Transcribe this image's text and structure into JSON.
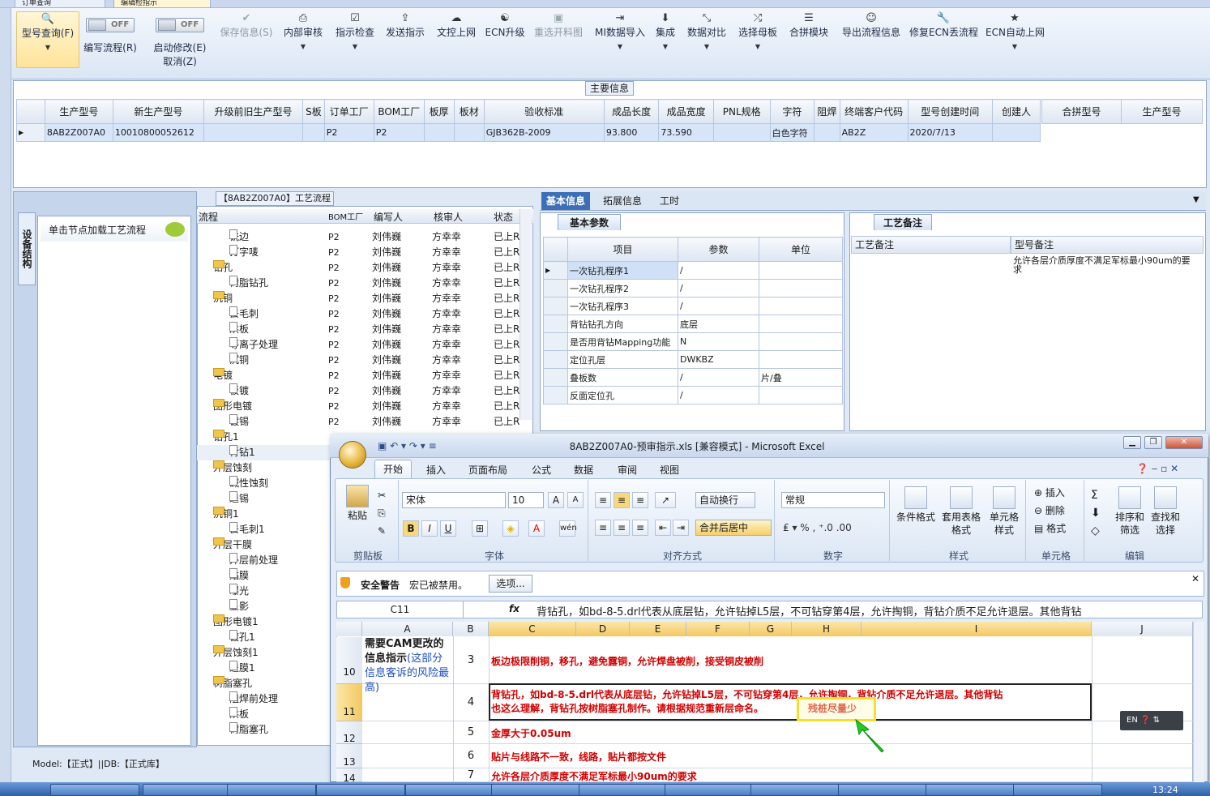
{
  "top_tabs": [
    "订单查询",
    "编辑检指示"
  ],
  "ribbon": {
    "model_query": "型号查询(F)",
    "toggle_off": "OFF",
    "write_flow": "编写流程(R)",
    "start_modify": "启动修改(E)",
    "cancel": "取消(Z)",
    "buttons": [
      "保存信息(S)",
      "内部审核",
      "指示检查",
      "发送指示",
      "文控上网",
      "ECN升级",
      "重选开料图",
      "MI数据导入",
      "集成",
      "数据对比",
      "选择母板",
      "合拼模块",
      "导出流程信息",
      "修复ECN丢流程",
      "ECN自动上网"
    ]
  },
  "main_info": {
    "title": "主要信息",
    "columns": [
      "生产型号",
      "新生产型号",
      "升级前旧生产型号",
      "S板",
      "订单工厂",
      "BOM工厂",
      "板厚",
      "板材",
      "验收标准",
      "成品长度",
      "成品宽度",
      "PNL规格",
      "字符",
      "阻焊",
      "终端客户代码",
      "型号创建时间",
      "创建人"
    ],
    "row": [
      "8AB2Z007A0",
      "10010800052612",
      "",
      "",
      "P2",
      "P2",
      "",
      "",
      "GJB362B-2009",
      "93.800",
      "73.590",
      "",
      "白色字符",
      "",
      "AB2Z",
      "2020/7/13",
      ""
    ],
    "merge_columns": [
      "合拼型号",
      "生产型号"
    ]
  },
  "left_panel": {
    "tab": "设备结构",
    "hint": "单击节点加载工艺流程"
  },
  "flow": {
    "title": "【8AB2Z007A0】工艺流程",
    "columns": [
      "流程",
      "BOM工厂",
      "编写人",
      "核审人",
      "状态"
    ],
    "rows": [
      {
        "n": "铣边",
        "t": "d",
        "l": 2,
        "b": "P2",
        "w": "刘伟巍",
        "r": "方幸幸",
        "s": "已上R"
      },
      {
        "n": "打字唛",
        "t": "d",
        "l": 2,
        "b": "P2",
        "w": "刘伟巍",
        "r": "方幸幸",
        "s": "已上R"
      },
      {
        "n": "钻孔",
        "t": "f",
        "l": 1,
        "b": "P2",
        "w": "刘伟巍",
        "r": "方幸幸",
        "s": "已上R"
      },
      {
        "n": "树脂钻孔",
        "t": "d",
        "l": 2,
        "b": "P2",
        "w": "刘伟巍",
        "r": "方幸幸",
        "s": "已上R"
      },
      {
        "n": "沉铜",
        "t": "f",
        "l": 1,
        "b": "P2",
        "w": "刘伟巍",
        "r": "方幸幸",
        "s": "已上R"
      },
      {
        "n": "去毛刺",
        "t": "d",
        "l": 2,
        "b": "P2",
        "w": "刘伟巍",
        "r": "方幸幸",
        "s": "已上R"
      },
      {
        "n": "烘板",
        "t": "d",
        "l": 2,
        "b": "P2",
        "w": "刘伟巍",
        "r": "方幸幸",
        "s": "已上R"
      },
      {
        "n": "等离子处理",
        "t": "d",
        "l": 2,
        "b": "P2",
        "w": "刘伟巍",
        "r": "方幸幸",
        "s": "已上R"
      },
      {
        "n": "沉铜",
        "t": "d",
        "l": 2,
        "b": "P2",
        "w": "刘伟巍",
        "r": "方幸幸",
        "s": "已上R"
      },
      {
        "n": "电镀",
        "t": "f",
        "l": 1,
        "b": "P2",
        "w": "刘伟巍",
        "r": "方幸幸",
        "s": "已上R"
      },
      {
        "n": "板镀",
        "t": "d",
        "l": 2,
        "b": "P2",
        "w": "刘伟巍",
        "r": "方幸幸",
        "s": "已上R"
      },
      {
        "n": "图形电镀",
        "t": "f",
        "l": 1,
        "b": "P2",
        "w": "刘伟巍",
        "r": "方幸幸",
        "s": "已上R"
      },
      {
        "n": "镀锡",
        "t": "d",
        "l": 2,
        "b": "P2",
        "w": "刘伟巍",
        "r": "方幸幸",
        "s": "已上R"
      },
      {
        "n": "钻孔1",
        "t": "f",
        "l": 1,
        "b": "",
        "w": "",
        "r": "",
        "s": ""
      },
      {
        "n": "背钻1",
        "t": "d",
        "l": 2,
        "b": "",
        "w": "",
        "r": "",
        "s": ""
      },
      {
        "n": "外层蚀刻",
        "t": "f",
        "l": 1,
        "b": "",
        "w": "",
        "r": "",
        "s": ""
      },
      {
        "n": "碱性蚀刻",
        "t": "d",
        "l": 2,
        "b": "",
        "w": "",
        "r": "",
        "s": ""
      },
      {
        "n": "退锡",
        "t": "d",
        "l": 2,
        "b": "",
        "w": "",
        "r": "",
        "s": ""
      },
      {
        "n": "沉铜1",
        "t": "f",
        "l": 1,
        "b": "",
        "w": "",
        "r": "",
        "s": ""
      },
      {
        "n": "去毛刺1",
        "t": "d",
        "l": 2,
        "b": "",
        "w": "",
        "r": "",
        "s": ""
      },
      {
        "n": "外层干膜",
        "t": "f",
        "l": 1,
        "b": "",
        "w": "",
        "r": "",
        "s": ""
      },
      {
        "n": "外层前处理",
        "t": "d",
        "l": 2,
        "b": "",
        "w": "",
        "r": "",
        "s": ""
      },
      {
        "n": "贴膜",
        "t": "d",
        "l": 2,
        "b": "",
        "w": "",
        "r": "",
        "s": ""
      },
      {
        "n": "曝光",
        "t": "d",
        "l": 2,
        "b": "",
        "w": "",
        "r": "",
        "s": ""
      },
      {
        "n": "显影",
        "t": "d",
        "l": 2,
        "b": "",
        "w": "",
        "r": "",
        "s": ""
      },
      {
        "n": "图形电镀1",
        "t": "f",
        "l": 1,
        "b": "",
        "w": "",
        "r": "",
        "s": ""
      },
      {
        "n": "镀孔1",
        "t": "d",
        "l": 2,
        "b": "",
        "w": "",
        "r": "",
        "s": ""
      },
      {
        "n": "外层蚀刻1",
        "t": "f",
        "l": 1,
        "b": "",
        "w": "",
        "r": "",
        "s": ""
      },
      {
        "n": "退膜1",
        "t": "d",
        "l": 2,
        "b": "",
        "w": "",
        "r": "",
        "s": ""
      },
      {
        "n": "树脂塞孔",
        "t": "f",
        "l": 1,
        "b": "",
        "w": "",
        "r": "",
        "s": ""
      },
      {
        "n": "阻焊前处理",
        "t": "d",
        "l": 2,
        "b": "",
        "w": "",
        "r": "",
        "s": ""
      },
      {
        "n": "烘板",
        "t": "d",
        "l": 2,
        "b": "",
        "w": "",
        "r": "",
        "s": ""
      },
      {
        "n": "树脂塞孔",
        "t": "d",
        "l": 2,
        "b": "",
        "w": "",
        "r": "",
        "s": ""
      }
    ]
  },
  "right_tabs": [
    "基本信息",
    "拓展信息",
    "工时"
  ],
  "basic_params": {
    "title": "基本参数",
    "columns": [
      "项目",
      "参数",
      "单位"
    ],
    "rows": [
      [
        "一次钻孔程序1",
        "/",
        ""
      ],
      [
        "一次钻孔程序2",
        "/",
        ""
      ],
      [
        "一次钻孔程序3",
        "/",
        ""
      ],
      [
        "背钻钻孔方向",
        "底层",
        ""
      ],
      [
        "是否用背钻Mapping功能",
        "N",
        ""
      ],
      [
        "定位孔层",
        "DWKBZ",
        ""
      ],
      [
        "叠板数",
        "/",
        "片/叠"
      ],
      [
        "反面定位孔",
        "/",
        ""
      ]
    ]
  },
  "craft_notes": {
    "title": "工艺备注",
    "col1": "工艺备注",
    "col2": "型号备注",
    "text": "允许各层介质厚度不满足军标最小90um的要求"
  },
  "status": "Model:【正式】||DB:【正式库】",
  "excel": {
    "title": "8AB2Z007A0-预审指示.xls  [兼容模式] - Microsoft Excel",
    "tabs": [
      "开始",
      "插入",
      "页面布局",
      "公式",
      "数据",
      "审阅",
      "视图"
    ],
    "font": "宋体",
    "size": "10",
    "wrap": "自动换行",
    "merge": "合并后居中",
    "numfmt": "常规",
    "groups": [
      "剪贴板",
      "字体",
      "对齐方式",
      "数字",
      "样式",
      "单元格",
      "编辑"
    ],
    "paste": "粘贴",
    "style_btns": [
      "条件格式",
      "套用表格格式",
      "单元格样式"
    ],
    "cell_btns": [
      "插入",
      "删除",
      "格式"
    ],
    "edit_btns": [
      "排序和筛选",
      "查找和选择"
    ],
    "security": "安全警告",
    "security_msg": "宏已被禁用。",
    "options": "选项...",
    "namebox": "C11",
    "formula": "背钻孔，如bd-8-5.drl代表从底层钻，允许钻掉L5层，不可钻穿第4层，允许掏铜，背钻介质不足允许退层。其他背钻",
    "columns": [
      "A",
      "B",
      "C",
      "D",
      "E",
      "F",
      "G",
      "H",
      "I",
      "J"
    ],
    "a_text_bold": "需要CAM更改的信息指示",
    "a_text_blue": "(这部分信息客诉的风险最高)",
    "rows": [
      {
        "r": "10",
        "b": "3",
        "c": "板边极限削铜，移孔，避免露铜，允许焊盘被削，接受铜皮被削"
      },
      {
        "r": "11",
        "b": "4",
        "c": "背钻孔，如bd-8-5.drl代表从底层钻，允许钻掉L5层，不可钻穿第4层，允许掏铜，背钻介质不足允许退层。其他背钻",
        "c2": "也这么理解，背钻孔按树脂塞孔制作。请根据规范重新层命名。",
        "hl": "残桩尽量少"
      },
      {
        "r": "12",
        "b": "5",
        "c": "金厚大于0.05um"
      },
      {
        "r": "13",
        "b": "6",
        "c": "贴片与线路不一致，线路，贴片都按文件"
      },
      {
        "r": "14",
        "b": "7",
        "c": "允许各层介质厚度不满足军标最小90um的要求"
      }
    ]
  },
  "ime": "EN",
  "clock": "13:24"
}
